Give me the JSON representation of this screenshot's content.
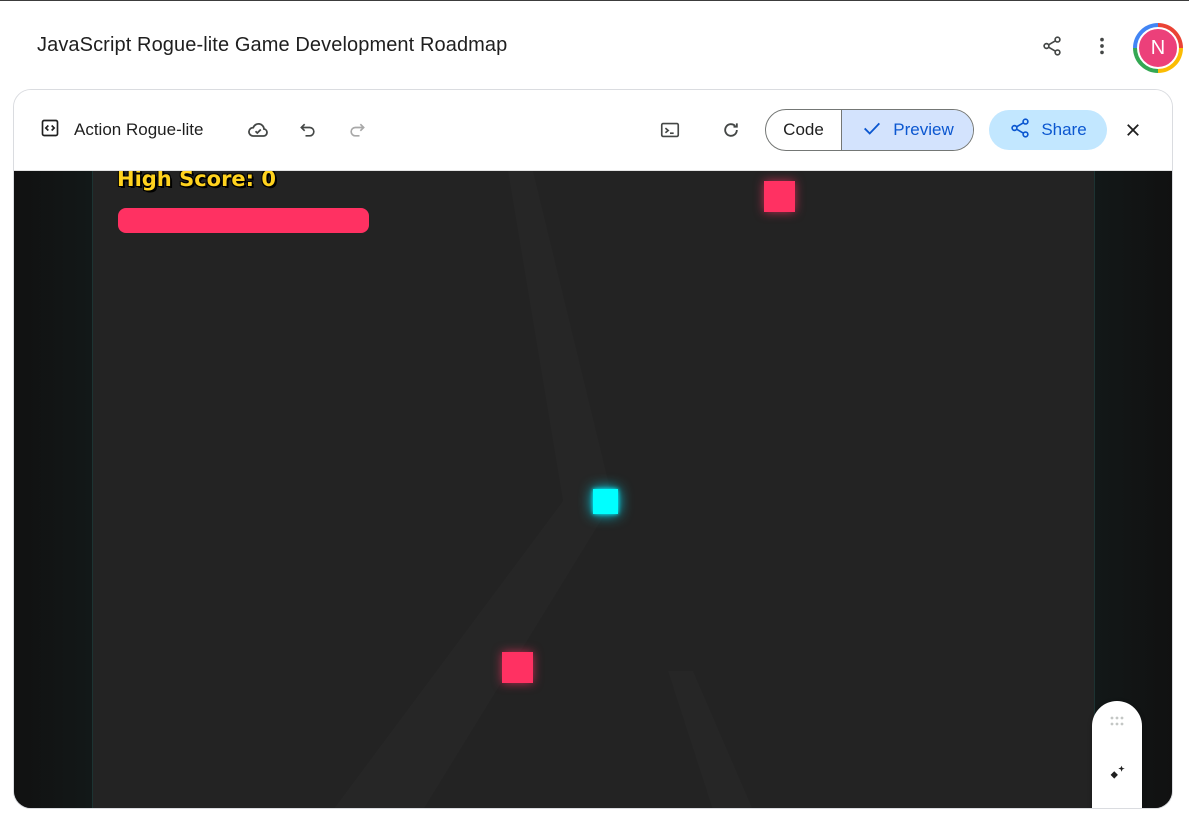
{
  "header": {
    "title": "JavaScript Rogue-lite Game Development Roadmap",
    "share_icon": "share-icon",
    "more_icon": "more-vert-icon",
    "avatar_letter": "N",
    "avatar_color": "#ec407a"
  },
  "toolbar": {
    "app_icon": "code-brackets-icon",
    "app_name": "Action Rogue-lite",
    "cloud_icon": "cloud-save-icon",
    "undo_icon": "undo-icon",
    "redo_icon": "redo-icon",
    "console_icon": "terminal-icon",
    "refresh_icon": "refresh-icon",
    "code_label": "Code",
    "preview_label": "Preview",
    "share_label": "Share",
    "close_icon": "close-icon"
  },
  "game": {
    "high_score_text": "High Score: 0",
    "health_fraction": 1.0,
    "colors": {
      "player": "#00ffff",
      "enemy": "#ff3162",
      "health": "#ff3162",
      "score": "#ffd21e",
      "arena": "#232323"
    }
  },
  "tool_pill": {
    "drag_icon": "drag-handle-icon",
    "sparkle_icon": "sparkle-edit-icon",
    "select_icon": "select-element-icon"
  }
}
